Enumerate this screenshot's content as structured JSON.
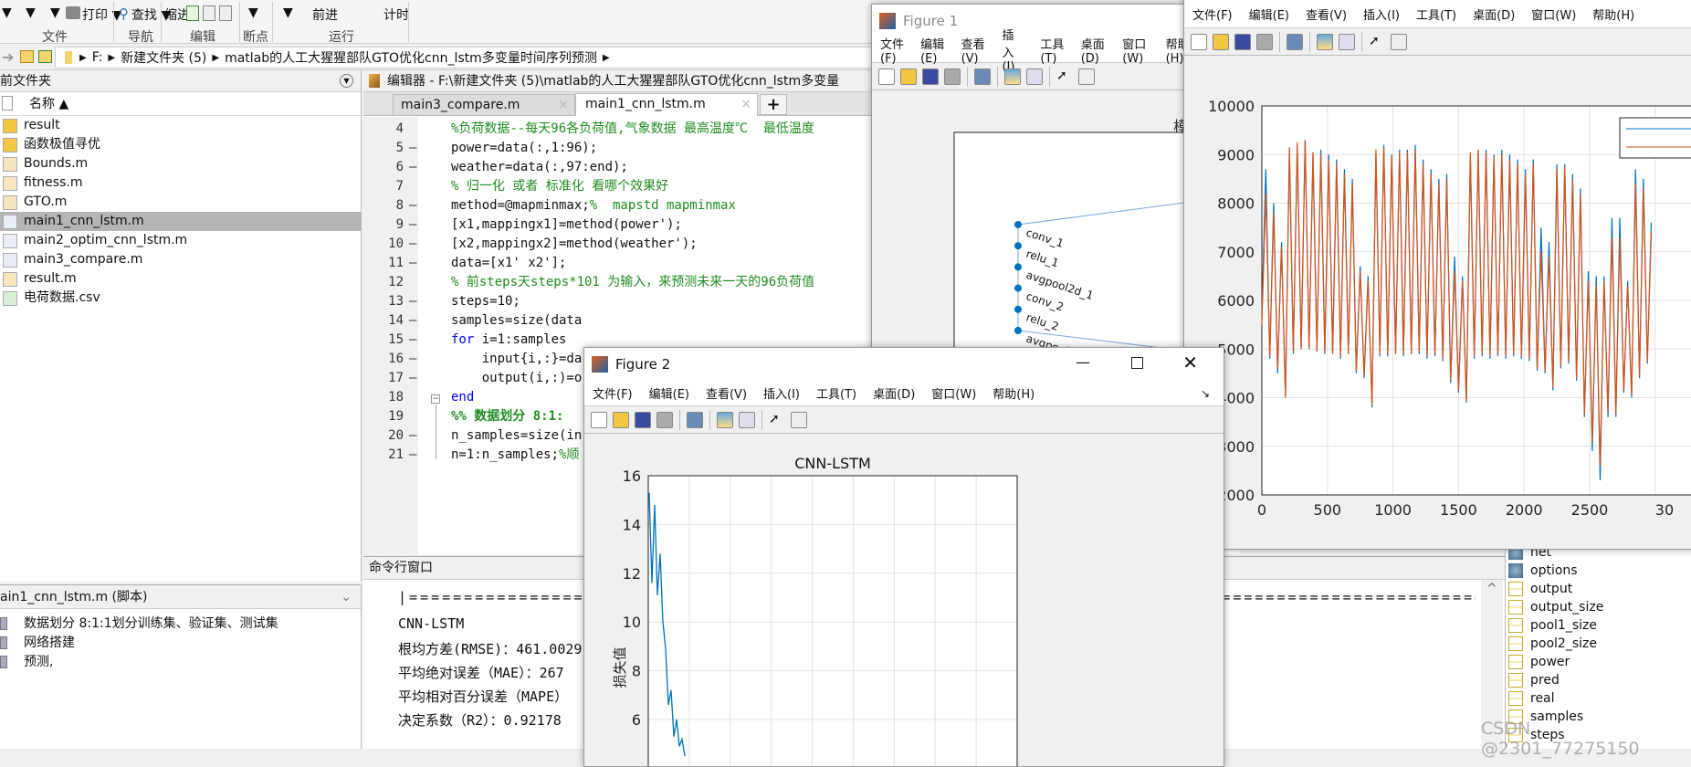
{
  "toolstrip": {
    "items": [
      "▼",
      "▼",
      "▼",
      "打印 ▼",
      "查找 ▼",
      "缩进",
      "▼",
      "▼",
      "前进",
      "计时"
    ],
    "groups": [
      "文件",
      "导航",
      "编辑",
      "断点",
      "运行"
    ]
  },
  "address": {
    "path": [
      "F:",
      "新建文件夹 (5)",
      "matlab的人工大猩猩部队GTO优化cnn_lstm多变量时间序列预测"
    ]
  },
  "current_folder": {
    "title": "前文件夹",
    "column": "名称 ▲",
    "files": [
      {
        "name": "result",
        "type": "folder"
      },
      {
        "name": "函数极值寻优",
        "type": "folder"
      },
      {
        "name": "Bounds.m",
        "type": "function"
      },
      {
        "name": "fitness.m",
        "type": "function"
      },
      {
        "name": "GTO.m",
        "type": "function"
      },
      {
        "name": "main1_cnn_lstm.m",
        "type": "script",
        "selected": true
      },
      {
        "name": "main2_optim_cnn_lstm.m",
        "type": "script"
      },
      {
        "name": "main3_compare.m",
        "type": "script"
      },
      {
        "name": "result.m",
        "type": "function"
      },
      {
        "name": "电荷数据.csv",
        "type": "csv"
      }
    ]
  },
  "details": {
    "title": "ain1_cnn_lstm.m  (脚本)",
    "sections": [
      "数据划分 8:1:1划分训练集、验证集、测试集",
      "网络搭建",
      "预测,"
    ]
  },
  "editor": {
    "title": "编辑器 - F:\\新建文件夹 (5)\\matlab的人工大猩猩部队GTO优化cnn_lstm多变量",
    "tabs": [
      "main3_compare.m",
      "main1_cnn_lstm.m"
    ],
    "active_tab": 1,
    "lines": [
      {
        "n": "4",
        "dash": "",
        "parts": [
          [
            "cm",
            "%负荷数据--每天96各负荷值,气象数据 最高温度℃  最低温度"
          ]
        ]
      },
      {
        "n": "5",
        "dash": "—",
        "parts": [
          [
            "",
            "power=data(:,1:96);"
          ]
        ]
      },
      {
        "n": "6",
        "dash": "—",
        "parts": [
          [
            "",
            "weather=data(:,97:end);"
          ]
        ]
      },
      {
        "n": "7",
        "dash": "",
        "parts": [
          [
            "cm",
            "% 归一化 或者 标准化 看哪个效果好"
          ]
        ]
      },
      {
        "n": "8",
        "dash": "—",
        "parts": [
          [
            "",
            "method=@mapminmax;"
          ],
          [
            "cm",
            "%  mapstd mapminmax"
          ]
        ]
      },
      {
        "n": "9",
        "dash": "—",
        "parts": [
          [
            "",
            "[x1,mappingx1]=method(power');"
          ]
        ]
      },
      {
        "n": "10",
        "dash": "—",
        "parts": [
          [
            "",
            "[x2,mappingx2]=method(weather');"
          ]
        ]
      },
      {
        "n": "11",
        "dash": "—",
        "parts": [
          [
            "",
            "data=[x1' x2'];"
          ]
        ]
      },
      {
        "n": "12",
        "dash": "",
        "parts": [
          [
            "cm",
            "% 前steps天steps*101 为输入，来预测未来一天的96负荷值"
          ]
        ]
      },
      {
        "n": "13",
        "dash": "—",
        "parts": [
          [
            "",
            "steps=10;"
          ]
        ]
      },
      {
        "n": "14",
        "dash": "—",
        "parts": [
          [
            "",
            "samples=size(data"
          ]
        ]
      },
      {
        "n": "15",
        "dash": "—",
        "parts": [
          [
            "kw",
            "for"
          ],
          [
            "",
            " i=1:samples"
          ]
        ]
      },
      {
        "n": "16",
        "dash": "—",
        "parts": [
          [
            "",
            "    input{i,:}=da"
          ]
        ]
      },
      {
        "n": "17",
        "dash": "—",
        "parts": [
          [
            "",
            "    output(i,:)=o"
          ]
        ]
      },
      {
        "n": "18",
        "dash": "",
        "parts": [
          [
            "kw",
            "end"
          ]
        ]
      },
      {
        "n": "19",
        "dash": "",
        "parts": [
          [
            "cm",
            "%% 数据划分 8:1:"
          ]
        ]
      },
      {
        "n": "20",
        "dash": "—",
        "parts": [
          [
            "",
            "n_samples=size(in"
          ]
        ]
      },
      {
        "n": "21",
        "dash": "—",
        "parts": [
          [
            "",
            "n=1:n_samples;"
          ],
          [
            "cm",
            "%顺"
          ]
        ]
      }
    ]
  },
  "command_window": {
    "title": "命令行窗口",
    "lines": [
      "|=========================================================================================================================================",
      "CNN-LSTM",
      "根均方差(RMSE)：461.0029",
      "平均绝对误差（MAE）：267",
      "平均相对百分误差（MAPE）",
      "决定系数（R2）：0.92178"
    ]
  },
  "workspace": {
    "items": [
      {
        "name": "net",
        "type": "object"
      },
      {
        "name": "options",
        "type": "object"
      },
      {
        "name": "output"
      },
      {
        "name": "output_size"
      },
      {
        "name": "pool1_size"
      },
      {
        "name": "pool2_size"
      },
      {
        "name": "power"
      },
      {
        "name": "pred"
      },
      {
        "name": "real"
      },
      {
        "name": "samples"
      },
      {
        "name": "steps"
      }
    ]
  },
  "figure_menu": [
    "文件(F)",
    "编辑(E)",
    "查看(V)",
    "插入(I)",
    "工具(T)",
    "桌面(D)",
    "窗口(W)",
    "帮助(H)"
  ],
  "figure1": {
    "title": "Figure 1",
    "axes_title": "模",
    "layers": [
      "conv_1",
      "relu_1",
      "avgpool2d_1",
      "conv_2",
      "relu_2",
      "avgpool2d_2"
    ]
  },
  "figure2": {
    "title": "Figure 2"
  },
  "watermark": "CSDN @2301_77275150",
  "colors": {
    "blue": "#0072bd",
    "orange": "#d95319",
    "selection": "#b5b5b5"
  },
  "chart_data": [
    {
      "type": "line",
      "title": "CNN-LSTM",
      "xlabel": "",
      "ylabel": "损失值",
      "ylim": [
        4,
        16
      ],
      "yticks": [
        "16",
        "14",
        "12",
        "10",
        "8",
        "6"
      ],
      "grid": true,
      "series": [
        {
          "values": [
            15.3,
            11.6,
            14.8,
            11.1,
            12.8,
            10.0,
            8.9,
            6.6,
            7.2,
            5.3,
            6.0,
            4.9,
            5.2,
            4.5
          ]
        }
      ]
    },
    {
      "type": "line",
      "xlim": [
        0,
        3000
      ],
      "ylim": [
        2000,
        10000
      ],
      "xticks": [
        "0",
        "500",
        "1000",
        "1500",
        "2000",
        "2500",
        "30"
      ],
      "yticks": [
        "10000",
        "9000",
        "8000",
        "7000",
        "6000",
        "5000",
        "4000",
        "3000",
        "2000"
      ],
      "grid": true,
      "legend": "top-right",
      "x": [
        0,
        30,
        60,
        90,
        120,
        150,
        180,
        210,
        240,
        270,
        300,
        330,
        360,
        390,
        420,
        450,
        480,
        510,
        540,
        570,
        600,
        630,
        660,
        690,
        720,
        750,
        780,
        810,
        840,
        870,
        900,
        930,
        960,
        990,
        1020,
        1050,
        1080,
        1110,
        1140,
        1170,
        1200,
        1230,
        1260,
        1290,
        1320,
        1350,
        1380,
        1410,
        1440,
        1470,
        1500,
        1530,
        1560,
        1590,
        1620,
        1650,
        1680,
        1710,
        1740,
        1770,
        1800,
        1830,
        1860,
        1890,
        1920,
        1950,
        1980,
        2010,
        2040,
        2070,
        2100,
        2130,
        2160,
        2190,
        2220,
        2250,
        2280,
        2310,
        2340,
        2370,
        2400,
        2430,
        2460,
        2490,
        2520,
        2550,
        2580,
        2610,
        2640,
        2670,
        2700,
        2730,
        2760,
        2790,
        2820,
        2850,
        2880,
        2910,
        2940,
        2970
      ],
      "series": [
        {
          "values": [
            5700,
            8700,
            4800,
            8000,
            4500,
            7200,
            4000,
            9100,
            4900,
            9200,
            5000,
            9300,
            5000,
            9000,
            4950,
            9100,
            4900,
            9000,
            4900,
            8900,
            4800,
            8700,
            4900,
            8500,
            4500,
            6700,
            4400,
            6500,
            3800,
            9000,
            4850,
            9200,
            4850,
            9000,
            4900,
            9100,
            4850,
            9100,
            4900,
            9200,
            4900,
            8900,
            4800,
            8700,
            4850,
            8500,
            4750,
            8600,
            4300,
            6900,
            4100,
            6500,
            3900,
            9000,
            4800,
            9100,
            4850,
            9100,
            4800,
            9000,
            4850,
            9100,
            4800,
            9000,
            4850,
            8900,
            4800,
            8700,
            4750,
            8900,
            4550,
            7500,
            4500,
            7200,
            4150,
            8800,
            4600,
            8800,
            4700,
            8600,
            4350,
            8300,
            3600,
            6600,
            2900,
            6500,
            2300,
            6500,
            3600,
            7700,
            3600,
            7700,
            4100,
            6400,
            4000,
            8700,
            4400,
            8500,
            4700,
            7600
          ]
        },
        {
          "values": [
            5500,
            8200,
            4850,
            7800,
            4600,
            7100,
            4000,
            9150,
            4950,
            9250,
            5000,
            9300,
            5000,
            9050,
            4950,
            9000,
            4950,
            8900,
            4900,
            8800,
            4850,
            8600,
            4900,
            8400,
            4550,
            6600,
            4450,
            6400,
            3850,
            9100,
            4900,
            9150,
            4900,
            8950,
            4900,
            9050,
            4900,
            9050,
            4900,
            9100,
            4950,
            8800,
            4850,
            8600,
            4900,
            8400,
            4800,
            8500,
            4350,
            6600,
            4150,
            6400,
            3950,
            9050,
            4850,
            9100,
            4900,
            9050,
            4850,
            8950,
            4900,
            9000,
            4850,
            8900,
            4900,
            8800,
            4850,
            8600,
            4800,
            8800,
            4600,
            7000,
            4550,
            6900,
            4200,
            8700,
            4650,
            8750,
            4750,
            8500,
            4400,
            8200,
            3650,
            6400,
            3100,
            6300,
            2600,
            6400,
            3700,
            7300,
            3650,
            7300,
            4150,
            6300,
            4050,
            8400,
            4450,
            8300,
            4750,
            7400
          ]
        }
      ]
    }
  ]
}
